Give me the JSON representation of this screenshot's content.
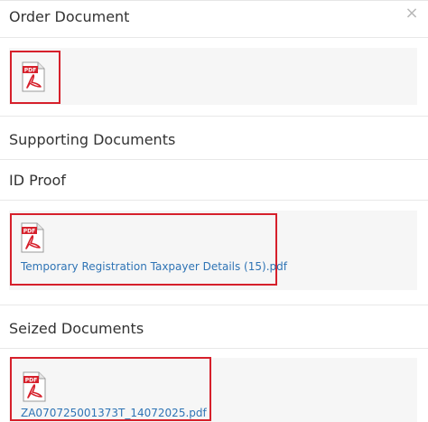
{
  "modal": {
    "close_symbol": "×",
    "close_icon": "close-icon"
  },
  "sections": {
    "order_document": {
      "title": "Order Document"
    },
    "supporting_documents": {
      "title": "Supporting Documents"
    },
    "id_proof": {
      "title": "ID Proof",
      "file_name": "Temporary Registration Taxpayer Details (15).pdf"
    },
    "seized_documents": {
      "title": "Seized Documents",
      "file_name": "ZA070725001373T_14072025.pdf"
    }
  },
  "pdf_icon": {
    "label": "PDF",
    "icon": "pdf-file-icon",
    "accent": "#d6202b"
  },
  "colors": {
    "highlight_border": "#d6202b",
    "link": "#2f74b5"
  }
}
